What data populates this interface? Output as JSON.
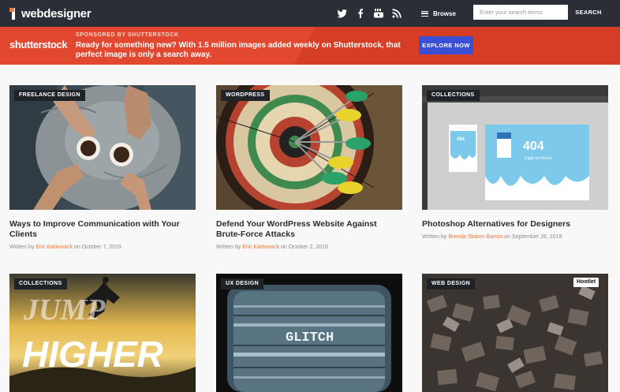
{
  "header": {
    "logo_digit": "1",
    "logo_text": "webdesigner",
    "social_icons": [
      "twitter-icon",
      "facebook-icon",
      "youtube-icon",
      "rss-icon"
    ],
    "browse_label": "Browse",
    "search_placeholder": "Enter your search terms",
    "search_button": "SEARCH"
  },
  "banner": {
    "brand": "shutterstock",
    "sponsor_label": "SPONSORED BY SHUTTERSTOCK",
    "message": "Ready for something new? With 1.5 million images added weekly on Shutterstock, that perfect image is only a search away.",
    "cta": "EXPLORE NOW"
  },
  "articles": [
    {
      "category": "FREELANCE DESIGN",
      "title": "Ways to Improve Communication with Your Clients",
      "by": "Written by",
      "author": "Eric Karkovack",
      "on": "on",
      "date": "October 7, 2019"
    },
    {
      "category": "WORDPRESS",
      "title": "Defend Your WordPress Website Against Brute-Force Attacks",
      "by": "Written by",
      "author": "Eric Karkovack",
      "on": "on",
      "date": "October 2, 2019"
    },
    {
      "category": "COLLECTIONS",
      "title": "Photoshop Alternatives for Designers",
      "by": "Written by",
      "author": "Brenda Stokes Barron",
      "on": "on",
      "date": "September 26, 2019",
      "image_text_big": "404",
      "image_text_small": "Page not found"
    },
    {
      "category": "COLLECTIONS",
      "image_text_top": "JUMP",
      "image_text_bottom": "HIGHER"
    },
    {
      "category": "UX DESIGN",
      "image_text": "GLITCH"
    },
    {
      "category": "WEB DESIGN",
      "image_badge": "Hootlet"
    }
  ],
  "colors": {
    "header_bg": "#2b2e36",
    "banner_bg": "#e1482f",
    "cta_bg": "#3a4fd4",
    "author_link": "#f07838"
  }
}
